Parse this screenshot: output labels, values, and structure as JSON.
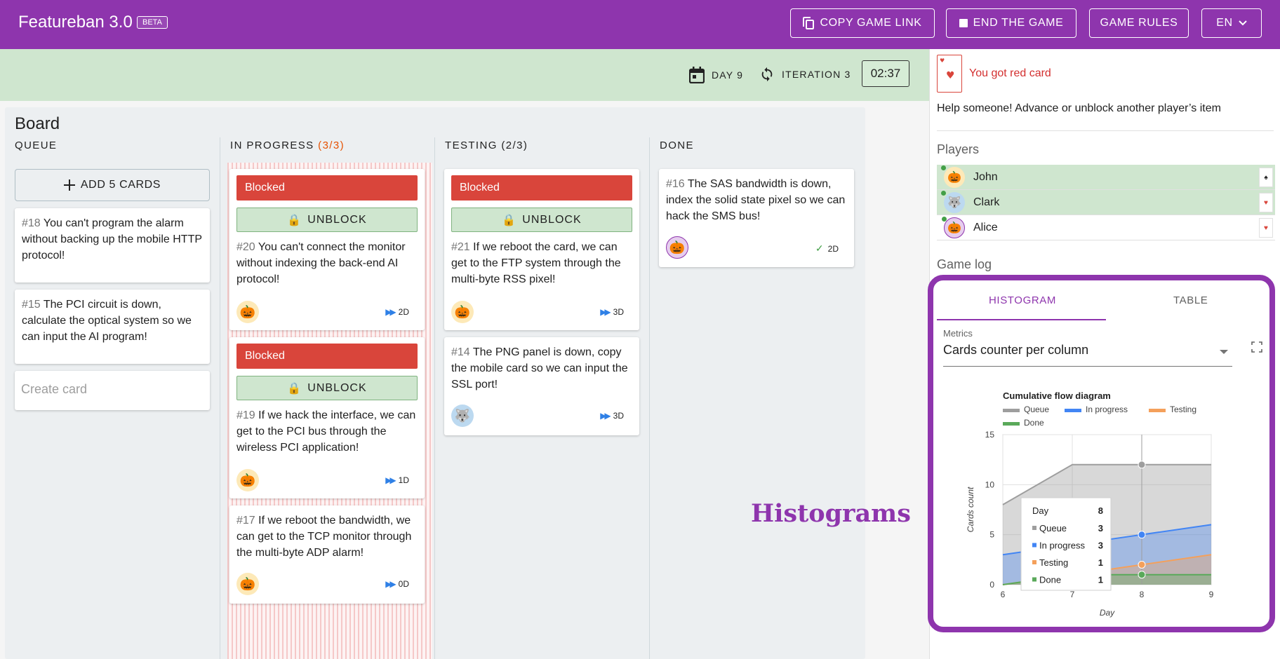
{
  "header": {
    "title": "Featureban 3.0",
    "badge": "BETA",
    "copy_link_label": "COPY GAME LINK",
    "end_game_label": "END THE GAME",
    "rules_label": "GAME RULES",
    "language": "EN"
  },
  "status": {
    "day": "DAY 9",
    "iteration": "ITERATION 3",
    "timer": "02:37"
  },
  "board": {
    "title": "Board",
    "add_cards_label": "ADD 5 CARDS",
    "create_card_placeholder": "Create card",
    "blocked_label": "Blocked",
    "unblock_label": "UNBLOCK",
    "columns": [
      {
        "name": "QUEUE",
        "count": ""
      },
      {
        "name": "IN PROGRESS",
        "count": "(3/3)"
      },
      {
        "name": "TESTING",
        "count": "(2/3)"
      },
      {
        "name": "DONE",
        "count": ""
      }
    ],
    "cards": {
      "c18": {
        "num": "#18",
        "text": " You can't program the alarm without backing up the mobile HTTP protocol!"
      },
      "c15": {
        "num": "#15",
        "text": " The PCI circuit is down, calculate the optical system so we can input the AI program!"
      },
      "c20": {
        "num": "#20",
        "text": " You can't connect the monitor without indexing the back-end AI protocol!",
        "est": "2D"
      },
      "c19": {
        "num": "#19",
        "text": " If we hack the interface, we can get to the PCI bus through the wireless PCI application!",
        "est": "1D"
      },
      "c17": {
        "num": "#17",
        "text": " If we reboot the bandwidth, we can get to the TCP monitor through the multi-byte ADP alarm!",
        "est": "0D"
      },
      "c21": {
        "num": "#21",
        "text": " If we reboot the card, we can get to the FTP system through the multi-byte RSS pixel!",
        "est": "3D"
      },
      "c14": {
        "num": "#14",
        "text": " The PNG panel is down, copy the mobile card so we can input the SSL port!",
        "est": "3D"
      },
      "c16": {
        "num": "#16",
        "text": " The SAS bandwidth is down, index the solid state pixel so we can hack the SMS bus!",
        "est": "2D"
      }
    }
  },
  "overlay_label": "Histograms",
  "side": {
    "red_card_text": "You got red card",
    "help_text": "Help someone! Advance or unblock another player’s item",
    "players_title": "Players",
    "players": [
      {
        "name": "John",
        "card": "♠"
      },
      {
        "name": "Clark",
        "card": "♥"
      },
      {
        "name": "Alice",
        "card": "♥"
      }
    ],
    "game_log_title": "Game log",
    "tabs": {
      "histogram": "HISTOGRAM",
      "table": "TABLE"
    },
    "metrics_label": "Metrics",
    "metrics_value": "Cards counter per column"
  },
  "colors": {
    "brand": "#8e35ad",
    "blocked": "#d9453b",
    "queue": "#9e9e9e",
    "in_progress": "#4285f4",
    "testing": "#f4a05b",
    "done": "#5aa95a"
  },
  "chart_data": {
    "type": "area",
    "title": "Cumulative flow diagram",
    "xlabel": "Day",
    "ylabel": "Cards count",
    "x": [
      6,
      7,
      8,
      9
    ],
    "ylim": [
      0,
      15
    ],
    "xlim": [
      6,
      9
    ],
    "yticks": [
      0,
      5,
      10,
      15
    ],
    "series": [
      {
        "name": "Queue",
        "values": [
          8,
          12,
          12,
          12
        ]
      },
      {
        "name": "In progress",
        "values": [
          3,
          4,
          5,
          6
        ]
      },
      {
        "name": "Testing",
        "values": [
          0,
          1,
          2,
          3
        ]
      },
      {
        "name": "Done",
        "values": [
          0,
          1,
          1,
          1
        ]
      }
    ],
    "tooltip": {
      "day_label": "Day",
      "day": "8",
      "rows": [
        {
          "name": "Queue",
          "value": "3"
        },
        {
          "name": "In progress",
          "value": "3"
        },
        {
          "name": "Testing",
          "value": "1"
        },
        {
          "name": "Done",
          "value": "1"
        }
      ]
    }
  }
}
